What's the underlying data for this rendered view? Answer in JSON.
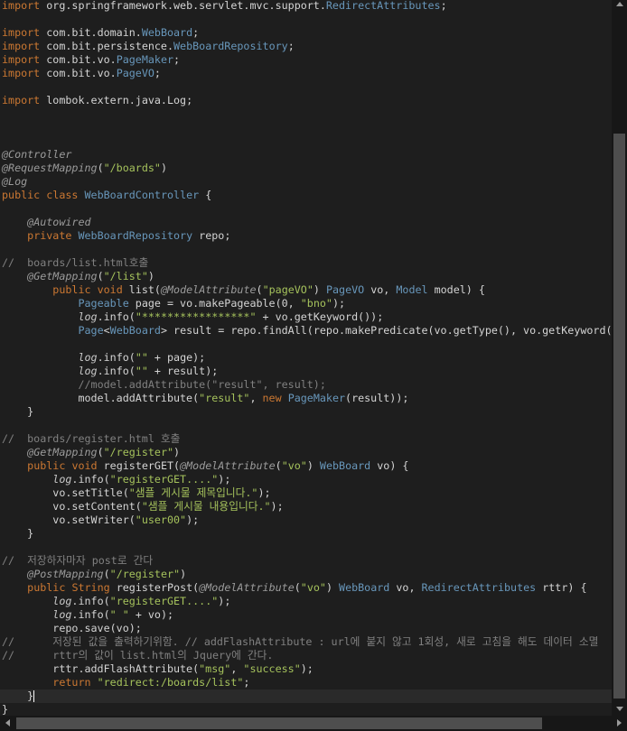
{
  "lines": [
    "import org.springframework.web.servlet.mvc.support.RedirectAttributes;",
    "",
    "import com.bit.domain.WebBoard;",
    "import com.bit.persistence.WebBoardRepository;",
    "import com.bit.vo.PageMaker;",
    "import com.bit.vo.PageVO;",
    "",
    "import lombok.extern.java.Log;",
    "",
    "",
    "",
    "@Controller",
    "@RequestMapping(\"/boards\")",
    "@Log",
    "public class WebBoardController {",
    "",
    "    @Autowired",
    "    private WebBoardRepository repo;",
    "",
    "//  boards/list.html호출",
    "    @GetMapping(\"/list\")",
    "        public void list(@ModelAttribute(\"pageVO\") PageVO vo, Model model) {",
    "            Pageable page = vo.makePageable(0, \"bno\");",
    "            log.info(\"*****************\" + vo.getKeyword());",
    "            Page<WebBoard> result = repo.findAll(repo.makePredicate(vo.getType(), vo.getKeyword()",
    "",
    "            log.info(\"\" + page);",
    "            log.info(\"\" + result);",
    "            //model.addAttribute(\"result\", result);",
    "            model.addAttribute(\"result\", new PageMaker(result));",
    "    }",
    "",
    "//  boards/register.html 호출",
    "    @GetMapping(\"/register\")",
    "    public void registerGET(@ModelAttribute(\"vo\") WebBoard vo) {",
    "        log.info(\"registerGET....\");",
    "        vo.setTitle(\"샘플 게시물 제목입니다.\");",
    "        vo.setContent(\"샘플 게시물 내용입니다.\");",
    "        vo.setWriter(\"user00\");",
    "    }",
    "",
    "//  저장하자마자 post로 간다",
    "    @PostMapping(\"/register\")",
    "    public String registerPost(@ModelAttribute(\"vo\") WebBoard vo, RedirectAttributes rttr) {",
    "        log.info(\"registerGET....\");",
    "        log.info(\" \" + vo);",
    "        repo.save(vo);",
    "//      저장된 값을 출력하기위함. // addFlashAttribute : url에 붙지 않고 1회성, 새로 고침을 해도 데이터 소멸",
    "//      rttr의 값이 list.html의 Jquery에 간다.",
    "        rttr.addFlashAttribute(\"msg\", \"success\");",
    "        return \"redirect:/boards/list\";",
    "    }",
    "}"
  ],
  "colors": {
    "background": "#1e1e1e",
    "keyword": "#cc7832",
    "annotation": "#9b9b9b",
    "string": "#a5c25c",
    "class": "#6897bb",
    "comment": "#808080",
    "current_line": "#2a2a2a"
  },
  "current_line_index": 51
}
